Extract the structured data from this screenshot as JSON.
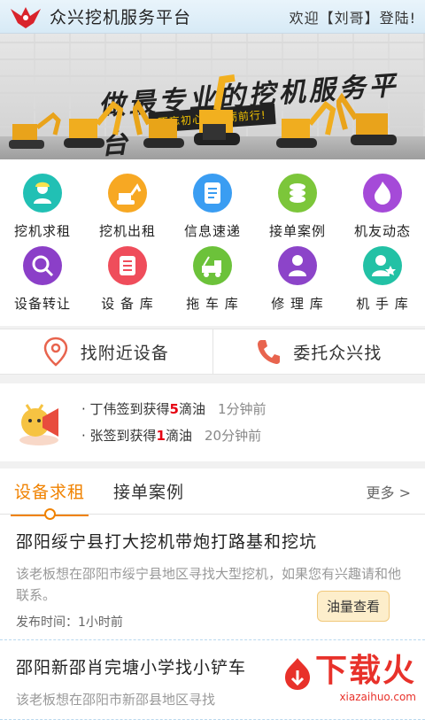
{
  "header": {
    "title": "众兴挖机服务平台",
    "welcome": "欢迎【刘哥】登陆!"
  },
  "banner": {
    "slogan": "做最专业的挖机服务平台",
    "sub_slogan": "不忘初心，砥砺前行!"
  },
  "grid": [
    {
      "label": "挖机求租",
      "icon": "worker-icon",
      "color": "#21c0b4"
    },
    {
      "label": "挖机出租",
      "icon": "excavator-icon",
      "color": "#f7a823"
    },
    {
      "label": "信息速递",
      "icon": "document-icon",
      "color": "#3a9df2"
    },
    {
      "label": "接单案例",
      "icon": "coins-icon",
      "color": "#7cc63a"
    },
    {
      "label": "机友动态",
      "icon": "flame-icon",
      "color": "#a54ad8"
    },
    {
      "label": "设备转让",
      "icon": "search-person-icon",
      "color": "#8b3fc8"
    },
    {
      "label": "设 备 库",
      "icon": "list-icon",
      "color": "#ef4d5b"
    },
    {
      "label": "拖 车 库",
      "icon": "tow-truck-icon",
      "color": "#6cc23a"
    },
    {
      "label": "修 理 库",
      "icon": "mechanic-icon",
      "color": "#8c44c9"
    },
    {
      "label": "机 手 库",
      "icon": "star-person-icon",
      "color": "#22c1a5"
    }
  ],
  "actions": {
    "nearby": "找附近设备",
    "entrust": "委托众兴找"
  },
  "news": [
    {
      "prefix": "· 丁伟签到获得",
      "num": "5",
      "suffix": "滴油",
      "time": "1分钟前"
    },
    {
      "prefix": "· 张签到获得",
      "num": "1",
      "suffix": "滴油",
      "time": "20分钟前"
    }
  ],
  "tabs": {
    "active": "设备求租",
    "other": "接单案例",
    "more": "更多 >"
  },
  "items": [
    {
      "title": "邵阳绥宁县打大挖机带炮打路基和挖坑",
      "desc": "该老板想在邵阳市绥宁县地区寻找大型挖机，如果您有兴趣请和他联系。",
      "time": "发布时间：1小时前",
      "button": "油量查看"
    },
    {
      "title": "邵阳新邵肖完塘小学找小铲车",
      "desc": "该老板想在邵阳市新邵县地区寻找",
      "time": ""
    }
  ],
  "watermark": {
    "text": "下载火",
    "url": "xiazaihuo.com"
  }
}
